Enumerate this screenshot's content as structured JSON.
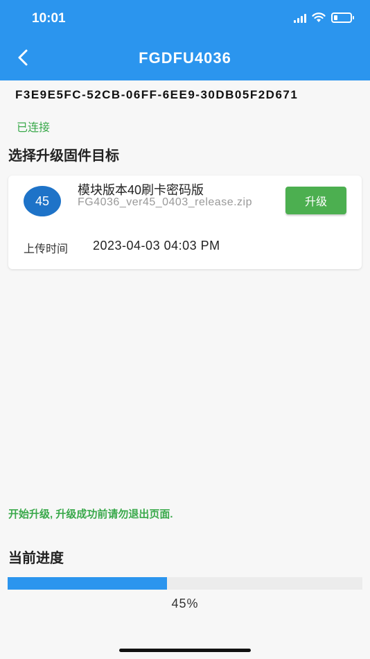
{
  "status_bar": {
    "time": "10:01"
  },
  "header": {
    "title": "FGDFU4036",
    "back_icon": "chevron-left-icon"
  },
  "device": {
    "id": "F3E9E5FC-52CB-06FF-6EE9-30DB05F2D671",
    "status": "已连接"
  },
  "section_title": "选择升级固件目标",
  "firmware": {
    "badge": "45",
    "name": "模块版本40刷卡密码版",
    "file": "FG4036_ver45_0403_release.zip",
    "upgrade_label": "升级",
    "upload_label": "上传时间",
    "upload_time": "2023-04-03 04:03 PM"
  },
  "tip": "开始升级, 升级成功前请勿退出页面.",
  "progress": {
    "title": "当前进度",
    "value": 45,
    "label": "45%"
  },
  "colors": {
    "header": "#2b95ee",
    "success": "#3aa94b",
    "button": "#4caf50",
    "badge": "#1e73c8",
    "progress": "#2b95ee"
  }
}
